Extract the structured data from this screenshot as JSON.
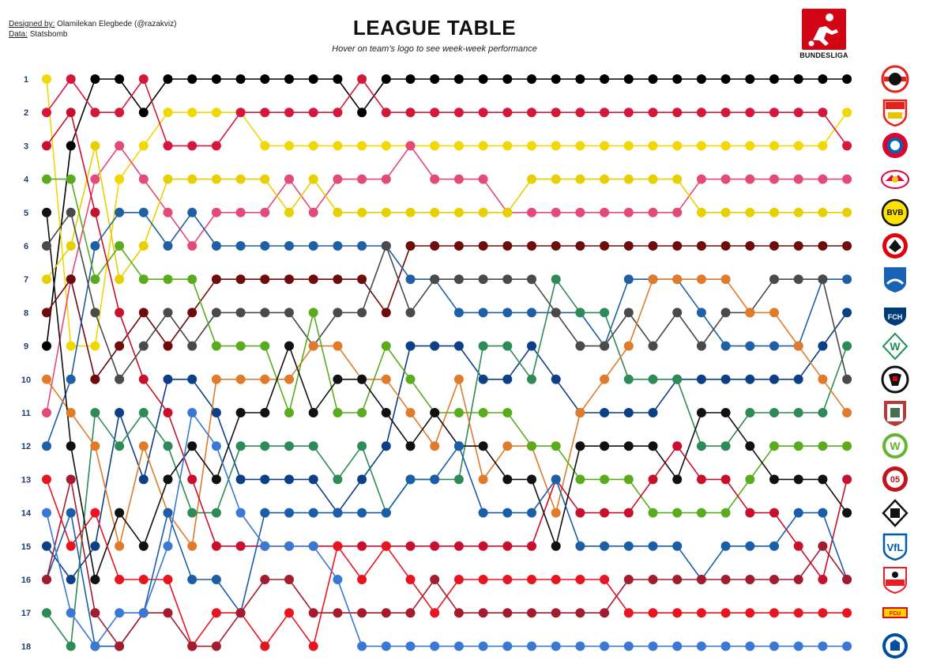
{
  "header": {
    "credit_label": "Designed by:",
    "credit_value": "Olamilekan Elegbede (@razakviz)",
    "data_label": "Data:",
    "data_value": "Statsbomb",
    "title": "LEAGUE TABLE",
    "subtitle": "Hover on team’s logo to see week-week performance",
    "logo_text": "BUNDESLIGA"
  },
  "chart_data": {
    "type": "line",
    "title": "LEAGUE TABLE",
    "subtitle": "Hover on team’s logo to see week-week performance",
    "xlabel": "",
    "ylabel": "",
    "ylim": [
      1,
      18
    ],
    "y_reversed": true,
    "y_ticks": [
      1,
      2,
      3,
      4,
      5,
      6,
      7,
      8,
      9,
      10,
      11,
      12,
      13,
      14,
      15,
      16,
      17,
      18
    ],
    "x": [
      1,
      2,
      3,
      4,
      5,
      6,
      7,
      8,
      9,
      10,
      11,
      12,
      13,
      14,
      15,
      16,
      17,
      18,
      19,
      20,
      21,
      22,
      23,
      24,
      25,
      26,
      27,
      28,
      29,
      30,
      31,
      32,
      33,
      34
    ],
    "grid": false,
    "legend": "team crests on the right, ordered by final position",
    "series": [
      {
        "color": "#000000",
        "crest_icon": "leverkusen-crest-icon",
        "values": [
          9,
          3,
          1,
          1,
          2,
          1,
          1,
          1,
          1,
          1,
          1,
          1,
          1,
          2,
          1,
          1,
          1,
          1,
          1,
          1,
          1,
          1,
          1,
          1,
          1,
          1,
          1,
          1,
          1,
          1,
          1,
          1,
          1,
          1
        ]
      },
      {
        "color": "#f0d800",
        "crest_icon": "stuttgart-crest-icon",
        "values": [
          1,
          9,
          9,
          4,
          3,
          2,
          2,
          2,
          2,
          3,
          3,
          3,
          3,
          3,
          3,
          3,
          3,
          3,
          3,
          3,
          3,
          3,
          3,
          3,
          3,
          3,
          3,
          3,
          3,
          3,
          3,
          3,
          3,
          2
        ]
      },
      {
        "color": "#d6173c",
        "crest_icon": "bayern-crest-icon",
        "values": [
          2,
          1,
          2,
          2,
          1,
          3,
          3,
          3,
          2,
          2,
          2,
          2,
          2,
          1,
          2,
          2,
          2,
          2,
          2,
          2,
          2,
          2,
          2,
          2,
          2,
          2,
          2,
          2,
          2,
          2,
          2,
          2,
          2,
          3
        ]
      },
      {
        "color": "#e34a78",
        "crest_icon": "leipzig-crest-icon",
        "values": [
          11,
          7,
          4,
          3,
          4,
          5,
          6,
          5,
          5,
          5,
          4,
          5,
          4,
          4,
          4,
          3,
          4,
          4,
          4,
          5,
          5,
          5,
          5,
          5,
          5,
          5,
          5,
          4,
          4,
          4,
          4,
          4,
          4,
          4
        ]
      },
      {
        "color": "#e8d000",
        "crest_icon": "dortmund-crest-icon",
        "values": [
          7,
          6,
          3,
          7,
          6,
          4,
          4,
          4,
          4,
          4,
          5,
          4,
          5,
          5,
          5,
          5,
          5,
          5,
          5,
          5,
          4,
          4,
          4,
          4,
          4,
          4,
          4,
          5,
          5,
          5,
          5,
          5,
          5,
          5
        ]
      },
      {
        "color": "#6e0b0b",
        "crest_icon": "frankfurt-crest-icon",
        "values": [
          8,
          7,
          10,
          9,
          8,
          9,
          8,
          7,
          7,
          7,
          7,
          7,
          7,
          7,
          8,
          6,
          6,
          6,
          6,
          6,
          6,
          6,
          6,
          6,
          6,
          6,
          6,
          6,
          6,
          6,
          6,
          6,
          6,
          6
        ]
      },
      {
        "color": "#1f5fa6",
        "crest_icon": "hoffenheim-crest-icon",
        "values": [
          12,
          10,
          6,
          5,
          5,
          6,
          5,
          6,
          6,
          6,
          6,
          6,
          6,
          6,
          6,
          7,
          7,
          8,
          8,
          8,
          8,
          8,
          8,
          9,
          7,
          7,
          7,
          8,
          9,
          9,
          9,
          9,
          7,
          7
        ]
      },
      {
        "color": "#0d3f86",
        "crest_icon": "heidenheim-crest-icon",
        "values": [
          15,
          16,
          15,
          11,
          13,
          10,
          10,
          11,
          13,
          13,
          13,
          13,
          14,
          13,
          12,
          9,
          9,
          9,
          10,
          10,
          9,
          10,
          11,
          11,
          11,
          11,
          10,
          10,
          10,
          10,
          10,
          10,
          9,
          8
        ]
      },
      {
        "color": "#2e8b57",
        "crest_icon": "bremen-crest-icon",
        "values": [
          17,
          18,
          11,
          12,
          11,
          12,
          14,
          14,
          12,
          12,
          12,
          12,
          13,
          12,
          14,
          13,
          13,
          13,
          9,
          9,
          10,
          7,
          8,
          8,
          10,
          10,
          10,
          12,
          12,
          11,
          11,
          11,
          11,
          9
        ]
      },
      {
        "color": "#4a4a4a",
        "crest_icon": "freiburg-crest-icon",
        "values": [
          6,
          5,
          8,
          10,
          9,
          8,
          9,
          8,
          8,
          8,
          8,
          9,
          8,
          8,
          6,
          8,
          7,
          7,
          7,
          7,
          7,
          8,
          9,
          9,
          8,
          9,
          8,
          9,
          8,
          8,
          7,
          7,
          7,
          10
        ]
      },
      {
        "color": "#e07b2a",
        "crest_icon": "augsburg-crest-icon",
        "values": [
          10,
          11,
          12,
          15,
          12,
          14,
          15,
          10,
          10,
          10,
          10,
          9,
          9,
          10,
          10,
          11,
          12,
          10,
          13,
          12,
          12,
          14,
          11,
          10,
          9,
          7,
          7,
          7,
          7,
          8,
          8,
          9,
          10,
          11
        ]
      },
      {
        "color": "#5aab1e",
        "crest_icon": "wolfsburg-crest-icon",
        "values": [
          4,
          4,
          7,
          6,
          7,
          7,
          7,
          9,
          9,
          9,
          11,
          8,
          11,
          11,
          9,
          10,
          11,
          11,
          11,
          11,
          12,
          12,
          13,
          13,
          13,
          14,
          14,
          14,
          14,
          13,
          12,
          12,
          12,
          12
        ]
      },
      {
        "color": "#c8102e",
        "crest_icon": "mainz-crest-icon",
        "values": [
          3,
          2,
          5,
          8,
          10,
          11,
          13,
          15,
          15,
          15,
          15,
          15,
          15,
          15,
          15,
          15,
          15,
          15,
          15,
          15,
          15,
          13,
          14,
          14,
          14,
          13,
          12,
          13,
          13,
          14,
          14,
          15,
          16,
          13
        ]
      },
      {
        "color": "#111111",
        "crest_icon": "gladbach-crest-icon",
        "values": [
          5,
          12,
          16,
          14,
          15,
          13,
          12,
          13,
          11,
          11,
          9,
          11,
          10,
          10,
          11,
          12,
          11,
          12,
          12,
          13,
          13,
          15,
          12,
          12,
          12,
          12,
          13,
          11,
          11,
          12,
          13,
          13,
          13,
          14
        ]
      },
      {
        "color": "#e8141f",
        "crest_icon": "union-berlin-crest-icon",
        "values": [
          13,
          15,
          14,
          16,
          16,
          16,
          18,
          17,
          17,
          18,
          17,
          18,
          15,
          16,
          15,
          16,
          17,
          16,
          16,
          16,
          16,
          16,
          16,
          16,
          17,
          17,
          17,
          17,
          17,
          17,
          17,
          17,
          17,
          17
        ]
      },
      {
        "color": "#1a5ea8",
        "crest_icon": "bochum-crest-icon",
        "values": [
          16,
          14,
          18,
          18,
          17,
          14,
          16,
          16,
          17,
          14,
          14,
          14,
          14,
          14,
          14,
          13,
          13,
          12,
          14,
          14,
          14,
          13,
          15,
          15,
          15,
          15,
          15,
          16,
          15,
          15,
          15,
          14,
          14,
          16
        ]
      },
      {
        "color": "#a31c2e",
        "crest_icon": "koln-crest-icon",
        "values": [
          16,
          13,
          17,
          18,
          17,
          17,
          18,
          18,
          17,
          16,
          16,
          17,
          17,
          17,
          17,
          17,
          16,
          17,
          17,
          17,
          17,
          17,
          17,
          17,
          16,
          16,
          16,
          16,
          16,
          16,
          16,
          16,
          15,
          16
        ]
      },
      {
        "color": "#3a78d4",
        "crest_icon": "darmstadt-crest-icon",
        "values": [
          14,
          17,
          18,
          17,
          17,
          15,
          11,
          12,
          14,
          15,
          15,
          15,
          16,
          18,
          18,
          18,
          18,
          18,
          18,
          18,
          18,
          18,
          18,
          18,
          18,
          18,
          18,
          18,
          18,
          18,
          18,
          18,
          18,
          18
        ]
      }
    ]
  }
}
